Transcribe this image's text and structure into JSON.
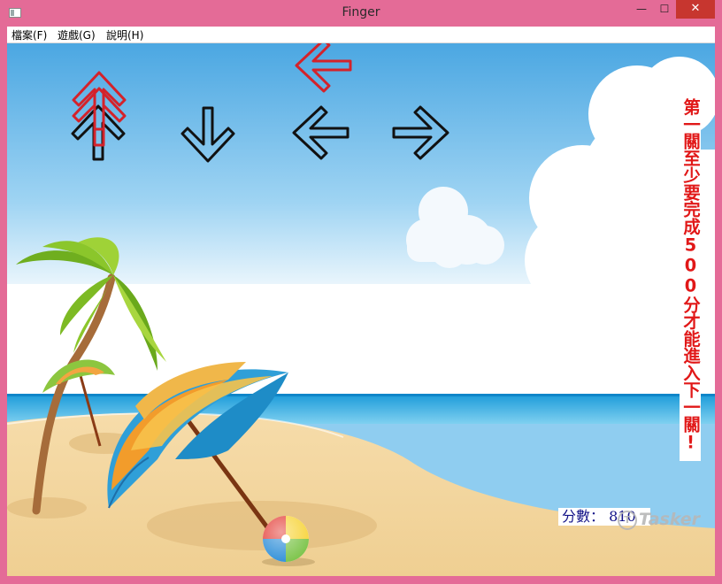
{
  "window": {
    "title": "Finger",
    "close_glyph": "✕",
    "minimize_glyph": "—",
    "maximize_glyph": "☐"
  },
  "menu": {
    "file": "檔案(F)",
    "game": "遊戲(G)",
    "help": "說明(H)"
  },
  "game": {
    "score_label": "分數：",
    "score_value": "810",
    "instruction": "第一關至少要完成500分才能進入下一關!",
    "watermark": "Tasker",
    "targets": [
      "up",
      "down",
      "left",
      "right"
    ],
    "falling_arrows": [
      "up",
      "up",
      "left"
    ]
  },
  "colors": {
    "window_frame": "#e46b97",
    "close_button": "#c7362f",
    "target_arrow": "#111111",
    "falling_arrow": "#d4222a",
    "instruction_text": "#e11818",
    "score_text": "#131388"
  }
}
